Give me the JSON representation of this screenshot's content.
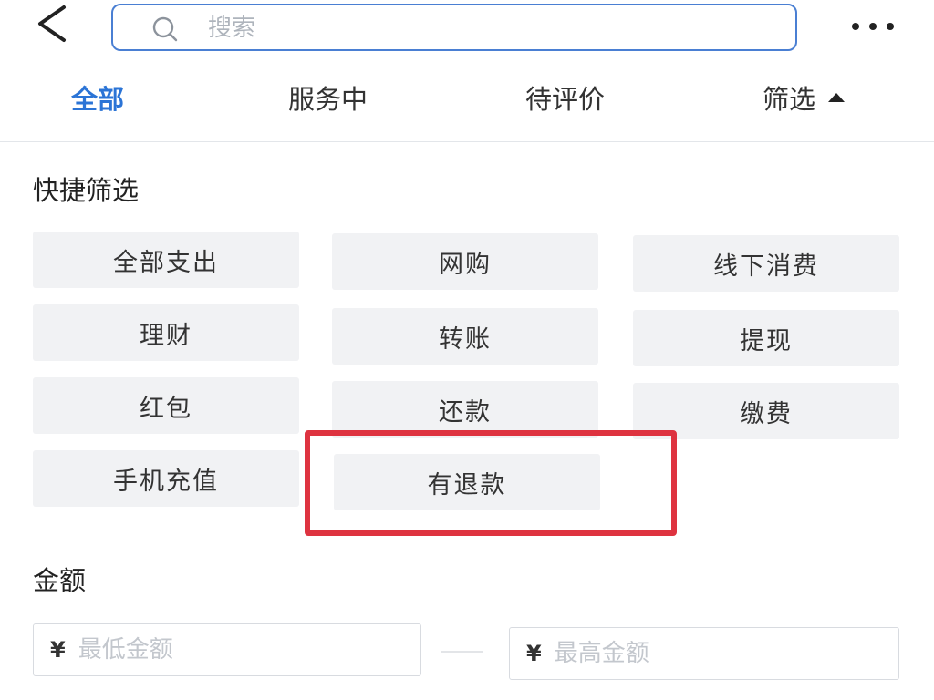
{
  "header": {
    "back_icon": "chevron-left-icon",
    "search_icon": "search-icon",
    "search_placeholder": "搜索",
    "search_value": "",
    "more_icon": "more-horizontal-icon"
  },
  "tabs": [
    {
      "label": "全部",
      "active": true
    },
    {
      "label": "服务中",
      "active": false
    },
    {
      "label": "待评价",
      "active": false
    },
    {
      "label": "筛选",
      "active": false,
      "icon": "caret-up-icon"
    }
  ],
  "quick_filter": {
    "title": "快捷筛选",
    "options": [
      "全部支出",
      "网购",
      "线下消费",
      "理财",
      "转账",
      "提现",
      "红包",
      "还款",
      "缴费",
      "手机充值",
      "有退款"
    ],
    "highlighted": "有退款",
    "highlight_color": "#de3340"
  },
  "amount": {
    "title": "金额",
    "currency_symbol": "¥",
    "min_placeholder": "最低金额",
    "max_placeholder": "最高金额",
    "min_value": "",
    "max_value": ""
  },
  "colors": {
    "accent": "#2b74d6",
    "search_border": "#4a7fd3",
    "chip_bg": "#f1f2f4"
  }
}
